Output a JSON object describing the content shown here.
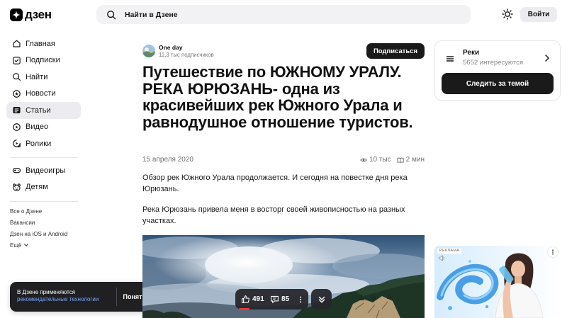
{
  "header": {
    "logo_text": "дзен",
    "search_placeholder": "Найти в Дзене",
    "login_label": "Войти"
  },
  "sidebar": {
    "nav": [
      {
        "label": "Главная",
        "icon": "home-icon"
      },
      {
        "label": "Подписки",
        "icon": "subscriptions-icon"
      },
      {
        "label": "Найти",
        "icon": "search-icon"
      },
      {
        "label": "Новости",
        "icon": "news-icon"
      },
      {
        "label": "Статьи",
        "icon": "articles-icon",
        "active": true
      },
      {
        "label": "Видео",
        "icon": "video-icon"
      },
      {
        "label": "Ролики",
        "icon": "shorts-icon"
      }
    ],
    "extra": [
      {
        "label": "Видеоигры",
        "icon": "gamepad-icon"
      },
      {
        "label": "Детям",
        "icon": "bear-icon"
      }
    ],
    "links": [
      "Все о Дзене",
      "Вакансии",
      "Дзен на iOS и Android"
    ],
    "more_label": "Ещё"
  },
  "cookie_notice": {
    "text": "В Дзене применяются",
    "link": "рекомендательные технологии",
    "accept_label": "Понятно"
  },
  "article": {
    "channel_name": "One day",
    "subscribers": "11,3 тыс подписчиков",
    "subscribe_label": "Подписаться",
    "title": "Путешествие по ЮЖНОМУ УРАЛУ. РЕКА ЮРЮЗАНЬ- одна из красивейших рек Южного Урала и равнодушное отношение туристов.",
    "date": "15 апреля 2020",
    "views": "10 тыс",
    "read_time": "2 мин",
    "paragraphs": [
      "Обзор рек Южного Урала продолжается. И сегодня на повестке дня река Юрюзань.",
      "Река Юрюзань привела меня в восторг своей живописностью на разных участках."
    ]
  },
  "reactions": {
    "likes": "491",
    "comments": "85",
    "read_progress": 0.16
  },
  "topic": {
    "name": "Реки",
    "interested": "5652 интересуются",
    "follow_label": "Следить за темой"
  },
  "ad": {
    "label": "РЕКЛАМА"
  },
  "colors": {
    "page_bg": "#ffffff",
    "primary_dark": "#1a1a1a",
    "search_bg": "#f2f2f4",
    "active_nav_bg": "#ececf0",
    "cookie_bg": "#202023",
    "cookie_link": "#7aa7ff",
    "progress": "#ff3b30"
  }
}
